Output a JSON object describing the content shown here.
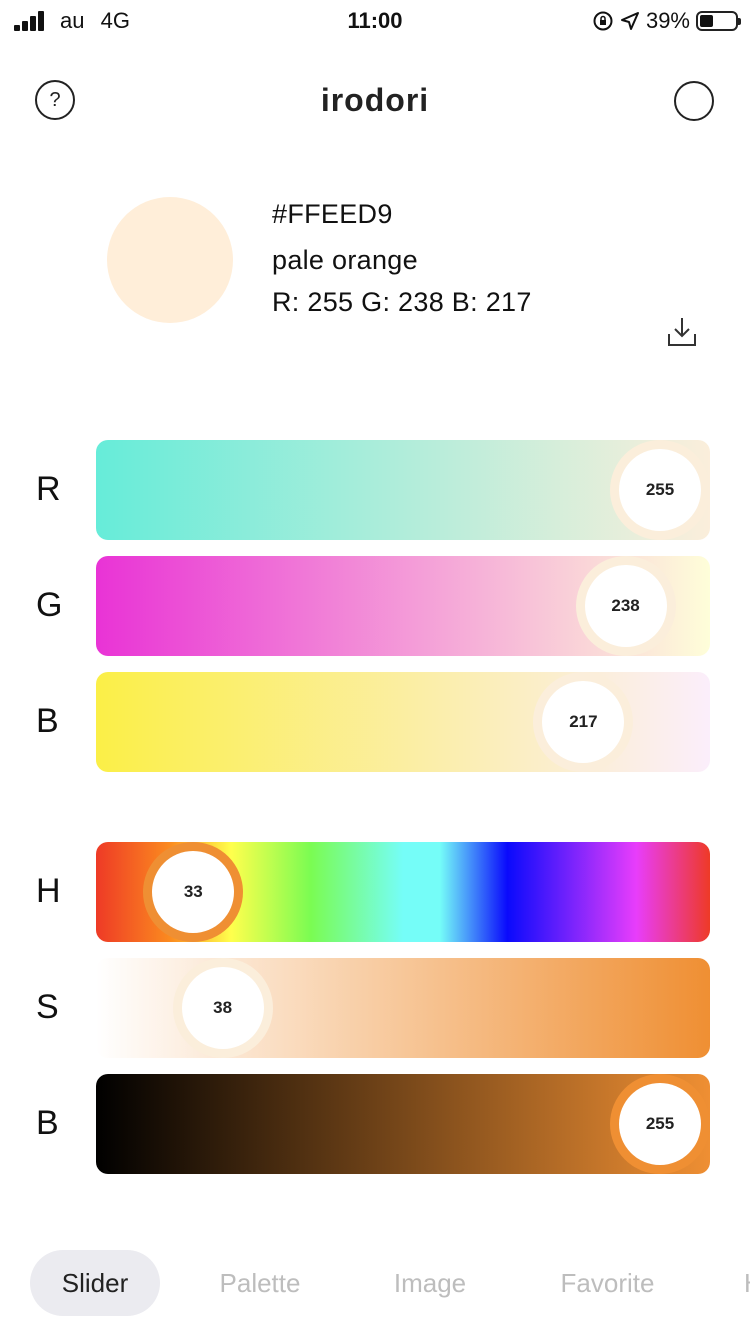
{
  "status_bar": {
    "carrier": "au",
    "network": "4G",
    "time": "11:00",
    "battery": "39%",
    "battery_level": 0.39
  },
  "header": {
    "title": "irodori",
    "help_label": "?"
  },
  "color": {
    "hex": "#FFEED9",
    "name": "pale orange",
    "rgb_text": "R: 255 G: 238 B: 217"
  },
  "sliders": {
    "rgb": [
      {
        "label": "R",
        "value": "255",
        "fraction": 1.0,
        "gradient": [
          "#66ecd9",
          "#fbeedb"
        ],
        "ring": "#fbeedb"
      },
      {
        "label": "G",
        "value": "238",
        "fraction": 0.933,
        "gradient": [
          "#e933d6",
          "#fefed9"
        ],
        "ring": "#fbeedb"
      },
      {
        "label": "B",
        "value": "217",
        "fraction": 0.851,
        "gradient": [
          "#fbef47",
          "#fbeefb"
        ],
        "ring": "#fbeedb"
      }
    ],
    "hsb": [
      {
        "label": "H",
        "value": "33",
        "fraction": 0.092,
        "ring": "#ef8f33"
      },
      {
        "label": "S",
        "value": "38",
        "fraction": 0.149,
        "gradient": [
          "#ffffff",
          "#ef8f33"
        ],
        "ring": "#fbeedb"
      },
      {
        "label": "B",
        "value": "255",
        "fraction": 1.0,
        "gradient": [
          "#000000",
          "#ef8f33"
        ],
        "ring": "#ef8f33"
      }
    ]
  },
  "tabs": [
    {
      "label": "Slider",
      "active": true
    },
    {
      "label": "Palette",
      "active": false
    },
    {
      "label": "Image",
      "active": false
    },
    {
      "label": "Favorite",
      "active": false
    },
    {
      "label": "H",
      "active": false
    }
  ],
  "colors": {
    "swatch": "#FFEED9",
    "accent": "#EF8F33"
  }
}
